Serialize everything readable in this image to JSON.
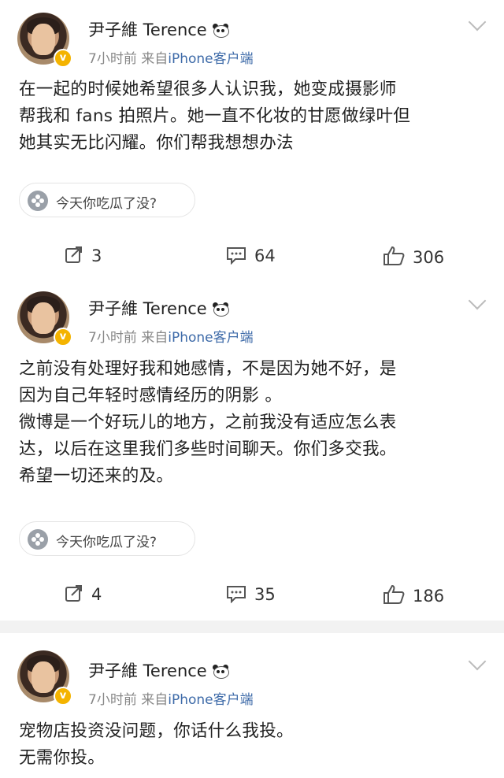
{
  "posts": [
    {
      "author": "尹子維 Terence",
      "time": "7小时前",
      "via": "来自",
      "source": "iPhone客户端",
      "text": "在一起的时候她希望很多人认识我，她变成摄影师\n帮我和 fans 拍照片。她一直不化妆的甘愿做绿叶但\n她其实无比闪耀。你们帮我想想办法",
      "topic": "今天你吃瓜了没?",
      "reposts": "3",
      "comments": "64",
      "likes": "306"
    },
    {
      "author": "尹子維 Terence",
      "time": "7小时前",
      "via": "来自",
      "source": "iPhone客户端",
      "text": "之前没有处理好我和她感情，不是因为她不好，是\n因为自己年轻时感情经历的阴影 。\n微博是一个好玩儿的地方，之前我没有适应怎么表\n达，以后在这里我们多些时间聊天。你们多交我。\n希望一切还来的及。",
      "topic": "今天你吃瓜了没?",
      "reposts": "4",
      "comments": "35",
      "likes": "186"
    },
    {
      "author": "尹子維 Terence",
      "time": "7小时前",
      "via": "来自",
      "source": "iPhone客户端",
      "text": "宠物店投资没问题，你话什么我投。\n无需你投。"
    }
  ],
  "badge": "v",
  "icons": {
    "repost": "repost-icon",
    "comment": "comment-icon",
    "like": "like-icon",
    "topic": "topic-icon",
    "emoji": "panda-emoji-icon",
    "more": "chevron-down-icon"
  },
  "colors": {
    "accent_source": "#3d6aa8",
    "vip_badge": "#f4b300"
  }
}
